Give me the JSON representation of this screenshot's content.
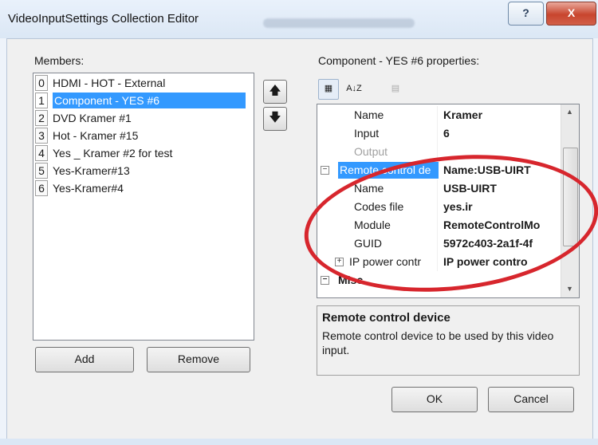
{
  "window": {
    "title": "VideoInputSettings Collection Editor",
    "help_label": "?",
    "close_label": "X"
  },
  "members": {
    "label": "Members:",
    "items": [
      {
        "index": "0",
        "name": "HDMI - HOT - External"
      },
      {
        "index": "1",
        "name": "Component - YES #6"
      },
      {
        "index": "2",
        "name": "DVD Kramer #1"
      },
      {
        "index": "3",
        "name": "Hot - Kramer #15"
      },
      {
        "index": "4",
        "name": "Yes _ Kramer #2 for test"
      },
      {
        "index": "5",
        "name": "Yes-Kramer#13"
      },
      {
        "index": "6",
        "name": "Yes-Kramer#4"
      }
    ],
    "move_up": "🡅",
    "move_down": "🡇",
    "add_label": "Add",
    "remove_label": "Remove"
  },
  "properties": {
    "label": "Component - YES #6 properties:",
    "toolbar": {
      "categorized": "▦",
      "alphabetical": "A↓Z",
      "pages": "▤"
    },
    "rows": [
      {
        "name": "Name",
        "value": "Kramer"
      },
      {
        "name": "Input",
        "value": "6"
      },
      {
        "name": "Output",
        "value": ""
      },
      {
        "name": "Remote control de",
        "value": "Name:USB-UIRT"
      },
      {
        "name": "Name",
        "value": "USB-UIRT"
      },
      {
        "name": "Codes file",
        "value": "yes.ir"
      },
      {
        "name": "Module",
        "value": "RemoteControlMo"
      },
      {
        "name": "GUID",
        "value": "5972c403-2a1f-4f"
      },
      {
        "name": "IP power contr",
        "value": "IP power contro"
      },
      {
        "name": "Misc",
        "value": ""
      }
    ],
    "expander_open": "−",
    "expander_closed": "+",
    "description": {
      "title": "Remote control device",
      "text": "Remote control device to be used by this video input."
    }
  },
  "dialog": {
    "ok_label": "OK",
    "cancel_label": "Cancel"
  },
  "colors": {
    "selection": "#3399ff",
    "annotation": "#d7262d"
  }
}
